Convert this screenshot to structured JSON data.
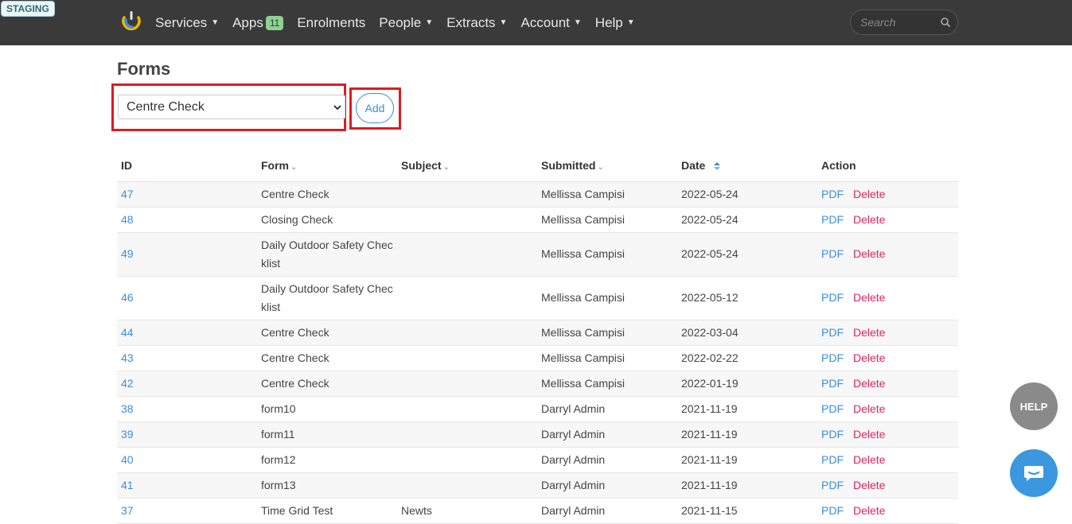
{
  "staging_label": "STAGING",
  "nav": {
    "services": "Services",
    "apps": "Apps",
    "apps_count": "11",
    "enrolments": "Enrolments",
    "people": "People",
    "extracts": "Extracts",
    "account": "Account",
    "help": "Help"
  },
  "search": {
    "placeholder": "Search"
  },
  "page": {
    "title": "Forms",
    "selected_form": "Centre Check",
    "add_label": "Add"
  },
  "table": {
    "headers": [
      "ID",
      "Form",
      "Subject",
      "Submitted",
      "Date",
      "Action"
    ],
    "rows": [
      {
        "id": "47",
        "form": "Centre Check",
        "subject": "",
        "submitted": "Mellissa Campisi",
        "date": "2022-05-24"
      },
      {
        "id": "48",
        "form": "Closing Check",
        "subject": "",
        "submitted": "Mellissa Campisi",
        "date": "2022-05-24"
      },
      {
        "id": "49",
        "form": "Daily Outdoor Safety Checklist",
        "subject": "",
        "submitted": "Mellissa Campisi",
        "date": "2022-05-24"
      },
      {
        "id": "46",
        "form": "Daily Outdoor Safety Checklist",
        "subject": "",
        "submitted": "Mellissa Campisi",
        "date": "2022-05-12"
      },
      {
        "id": "44",
        "form": "Centre Check",
        "subject": "",
        "submitted": "Mellissa Campisi",
        "date": "2022-03-04"
      },
      {
        "id": "43",
        "form": "Centre Check",
        "subject": "",
        "submitted": "Mellissa Campisi",
        "date": "2022-02-22"
      },
      {
        "id": "42",
        "form": "Centre Check",
        "subject": "",
        "submitted": "Mellissa Campisi",
        "date": "2022-01-19"
      },
      {
        "id": "38",
        "form": "form10",
        "subject": "",
        "submitted": "Darryl Admin",
        "date": "2021-11-19"
      },
      {
        "id": "39",
        "form": "form11",
        "subject": "",
        "submitted": "Darryl Admin",
        "date": "2021-11-19"
      },
      {
        "id": "40",
        "form": "form12",
        "subject": "",
        "submitted": "Darryl Admin",
        "date": "2021-11-19"
      },
      {
        "id": "41",
        "form": "form13",
        "subject": "",
        "submitted": "Darryl Admin",
        "date": "2021-11-19"
      },
      {
        "id": "37",
        "form": "Time Grid Test",
        "subject": "Newts",
        "submitted": "Darryl Admin",
        "date": "2021-11-15"
      }
    ],
    "pdf_label": "PDF",
    "delete_label": "Delete"
  },
  "widgets": {
    "help_label": "HELP"
  },
  "colors": {
    "topbar": "#3a3a3a",
    "link": "#3a8fd8",
    "delete": "#e0245e",
    "highlight": "#dd1b22"
  }
}
